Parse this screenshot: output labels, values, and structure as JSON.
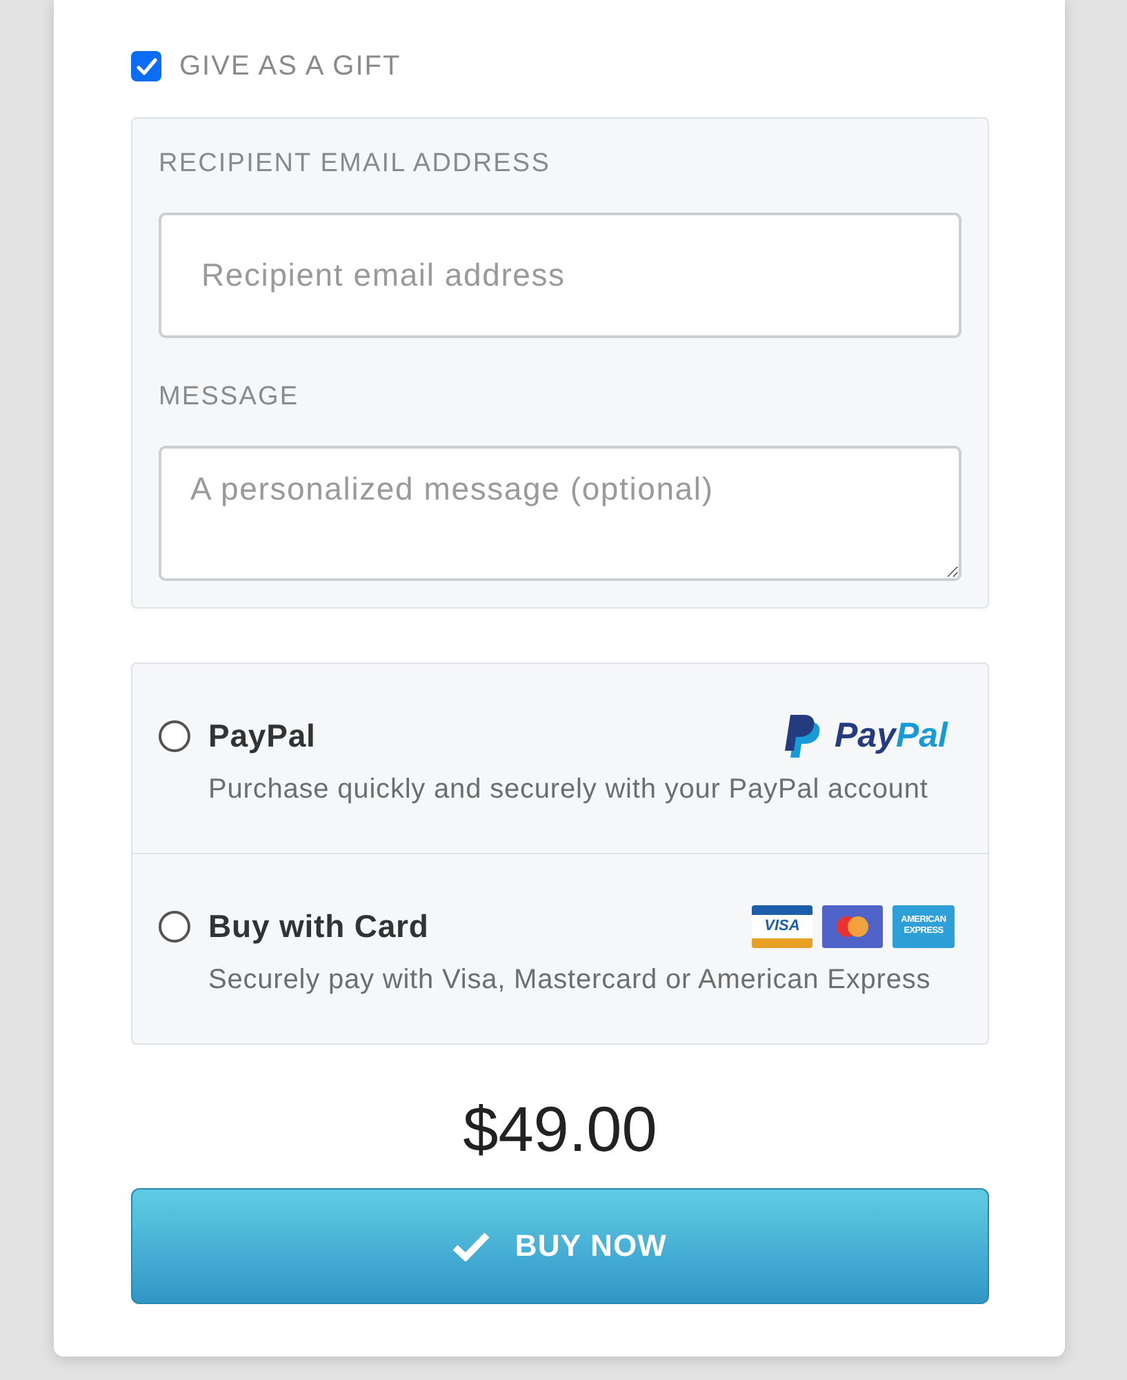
{
  "gift": {
    "label": "GIVE AS A GIFT",
    "checked": true,
    "fields": [
      {
        "kind": "input",
        "label": "RECIPIENT EMAIL ADDRESS",
        "placeholder": "Recipient email address"
      },
      {
        "kind": "textarea",
        "label": "MESSAGE",
        "placeholder": "A personalized message (optional)"
      }
    ]
  },
  "payment_methods": [
    {
      "kind": "paypal",
      "title": "PayPal",
      "description": "Purchase quickly and securely with your PayPal account",
      "selected": false,
      "logo": "PayPal"
    },
    {
      "kind": "card",
      "title": "Buy with Card",
      "description": "Securely pay with Visa, Mastercard or American Express",
      "selected": false,
      "cards": [
        {
          "kind": "visa",
          "label": "VISA"
        },
        {
          "kind": "mastercard"
        },
        {
          "kind": "amex",
          "label": "AMERICAN EXPRESS"
        }
      ]
    }
  ],
  "price": "$49.00",
  "buy_button": {
    "label": "BUY NOW"
  }
}
